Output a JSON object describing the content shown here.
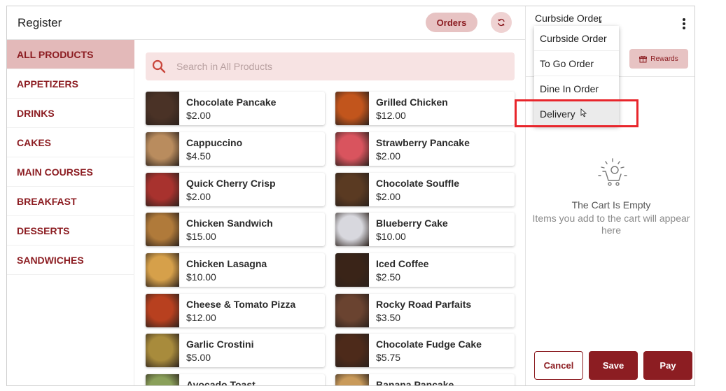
{
  "header": {
    "title": "Register",
    "orders_label": "Orders",
    "refresh_icon": "refresh-icon"
  },
  "sidebar": {
    "items": [
      {
        "label": "ALL PRODUCTS",
        "active": true
      },
      {
        "label": "APPETIZERS"
      },
      {
        "label": "DRINKS"
      },
      {
        "label": "CAKES"
      },
      {
        "label": "MAIN COURSES"
      },
      {
        "label": "BREAKFAST"
      },
      {
        "label": "DESSERTS"
      },
      {
        "label": "SANDWICHES"
      }
    ]
  },
  "search": {
    "placeholder": "Search in All Products",
    "value": ""
  },
  "products": [
    {
      "name": "Chocolate Pancake",
      "price": "$2.00",
      "color": "#4a3226"
    },
    {
      "name": "Grilled Chicken",
      "price": "$12.00",
      "color": "#c2551c"
    },
    {
      "name": "Cappuccino",
      "price": "$4.50",
      "color": "#b98c5e"
    },
    {
      "name": "Strawberry Pancake",
      "price": "$2.00",
      "color": "#d9545e"
    },
    {
      "name": "Quick Cherry Crisp",
      "price": "$2.00",
      "color": "#a8322e"
    },
    {
      "name": "Chocolate Souffle",
      "price": "$2.00",
      "color": "#5a3a22"
    },
    {
      "name": "Chicken Sandwich",
      "price": "$15.00",
      "color": "#b07a3a"
    },
    {
      "name": "Blueberry Cake",
      "price": "$10.00",
      "color": "#d8d8de"
    },
    {
      "name": "Chicken Lasagna",
      "price": "$10.00",
      "color": "#d6a04a"
    },
    {
      "name": "Iced Coffee",
      "price": "$2.50",
      "color": "#3a2418"
    },
    {
      "name": "Cheese & Tomato Pizza",
      "price": "$12.00",
      "color": "#b8401f"
    },
    {
      "name": "Rocky Road Parfaits",
      "price": "$3.50",
      "color": "#6a4330"
    },
    {
      "name": "Garlic Crostini",
      "price": "$5.00",
      "color": "#a88b3c"
    },
    {
      "name": "Chocolate Fudge Cake",
      "price": "$5.75",
      "color": "#4d2a1a"
    },
    {
      "name": "Avocado Toast",
      "price": "",
      "color": "#8aa05a"
    },
    {
      "name": "Banana Pancake",
      "price": "",
      "color": "#c99a5a"
    }
  ],
  "cart": {
    "order_type": "Curbside Order",
    "rewards_label": "Rewards",
    "empty_title": "The Cart Is Empty",
    "empty_message": "Items you add to the cart will appear here",
    "cancel_label": "Cancel",
    "save_label": "Save",
    "pay_label": "Pay"
  },
  "order_type_dropdown": {
    "options": [
      "Curbside Order",
      "To Go Order",
      "Dine In Order",
      "Delivery"
    ],
    "hovered": "Delivery"
  },
  "colors": {
    "brand": "#8c1d22",
    "accent_light": "#e7c3c3",
    "highlight": "#e8262c"
  }
}
